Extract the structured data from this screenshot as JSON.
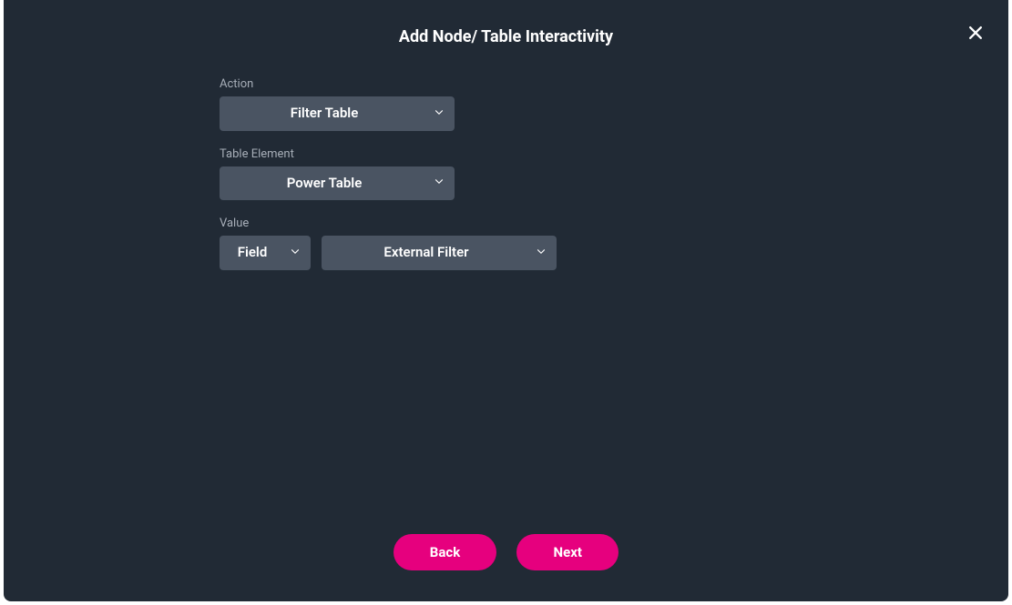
{
  "modal": {
    "title": "Add Node/ Table Interactivity"
  },
  "form": {
    "action_label": "Action",
    "action_value": "Filter Table",
    "table_element_label": "Table Element",
    "table_element_value": "Power Table",
    "value_label": "Value",
    "value_type": "Field",
    "value_filter": "External Filter"
  },
  "buttons": {
    "back": "Back",
    "next": "Next"
  }
}
